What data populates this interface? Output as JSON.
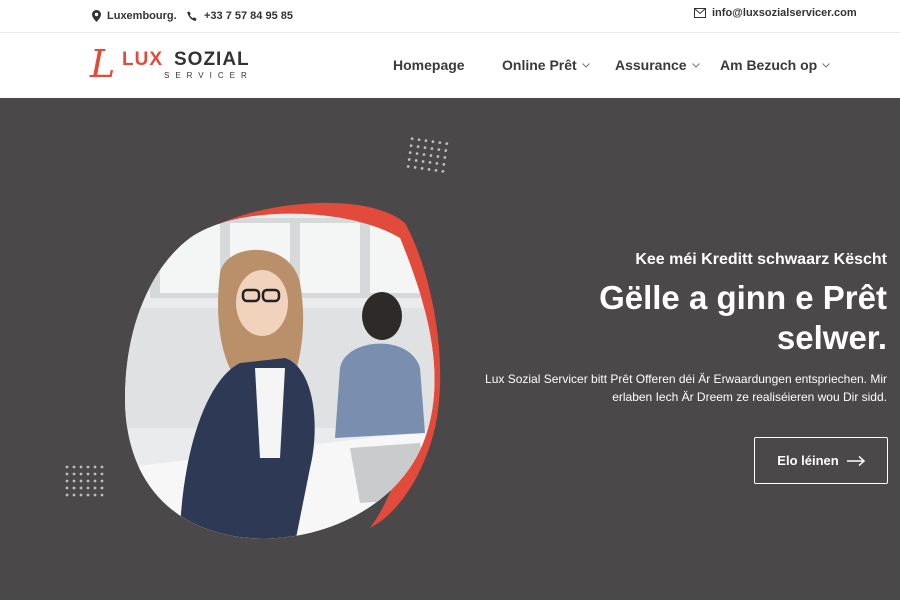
{
  "topbar": {
    "location": "Luxembourg.",
    "phone": "+33 7 57 84 95 85",
    "email": "info@luxsozialservicer.com"
  },
  "logo": {
    "mark": "L",
    "brand_1": "LUX",
    "brand_2": "SOZIAL",
    "tagline": "SERVICER"
  },
  "nav": {
    "items": [
      {
        "label": "Homepage",
        "has_dropdown": false
      },
      {
        "label": "Online Prêt",
        "has_dropdown": true
      },
      {
        "label": "Assurance",
        "has_dropdown": true
      },
      {
        "label": "Am Bezuch op",
        "has_dropdown": true
      }
    ]
  },
  "hero": {
    "subheading": "Kee méi Kreditt schwaarz Këscht",
    "headline": "Gëlle a ginn e Prêt selwer.",
    "description": "Lux Sozial Servicer bitt Prêt Offeren déi Är Erwaardungen entspriechen. Mir erlaben Iech Är Dreem ze realiséieren wou Dir sidd.",
    "cta_label": "Elo léinen"
  },
  "colors": {
    "accent": "#e24b3b",
    "hero_bg": "#4a4849",
    "text_dark": "#333333"
  },
  "icons": [
    "map-pin-icon",
    "phone-icon",
    "envelope-icon",
    "chevron-down-icon",
    "arrow-right-icon"
  ]
}
